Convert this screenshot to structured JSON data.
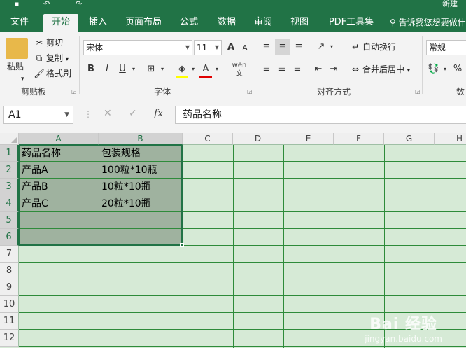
{
  "titlebar": {
    "doc_title": "新建"
  },
  "tabs": [
    {
      "label": "文件"
    },
    {
      "label": "开始"
    },
    {
      "label": "插入"
    },
    {
      "label": "页面布局"
    },
    {
      "label": "公式"
    },
    {
      "label": "数据"
    },
    {
      "label": "审阅"
    },
    {
      "label": "视图"
    },
    {
      "label": "PDF工具集"
    }
  ],
  "tellme": "告诉我您想要做什么",
  "ribbon": {
    "clipboard": {
      "paste": "粘贴",
      "cut": "剪切",
      "copy": "复制",
      "format_painter": "格式刷",
      "group": "剪贴板"
    },
    "font": {
      "name": "宋体",
      "size": "11",
      "bold": "B",
      "italic": "I",
      "underline": "U",
      "grow": "A",
      "shrink": "A",
      "group": "字体",
      "phonetic": "wén"
    },
    "alignment": {
      "wrap": "自动换行",
      "merge": "合并后居中",
      "group": "对齐方式"
    },
    "number": {
      "format": "常规",
      "group": "数"
    }
  },
  "formula_bar": {
    "name_box": "A1",
    "cancel": "✕",
    "enter": "✓",
    "fx": "fx",
    "content": "药品名称"
  },
  "columns": [
    "A",
    "B",
    "C",
    "D",
    "E",
    "F",
    "G",
    "H"
  ],
  "rows": [
    "1",
    "2",
    "3",
    "4",
    "5",
    "6",
    "7",
    "8",
    "9",
    "10",
    "11",
    "12"
  ],
  "cells": {
    "A1": "药品名称",
    "B1": "包装规格",
    "A2": "产品A",
    "B2": "100粒*10瓶",
    "A3": "产品B",
    "B3": "10粒*10瓶",
    "A4": "产品C",
    "B4": "20粒*10瓶"
  },
  "watermark": {
    "main": "Bai 经验",
    "sub": "jingyan.baidu.com"
  },
  "colors": {
    "accent": "#217346",
    "grid_bg": "#d6ead6",
    "selection": "#9fb29f"
  }
}
